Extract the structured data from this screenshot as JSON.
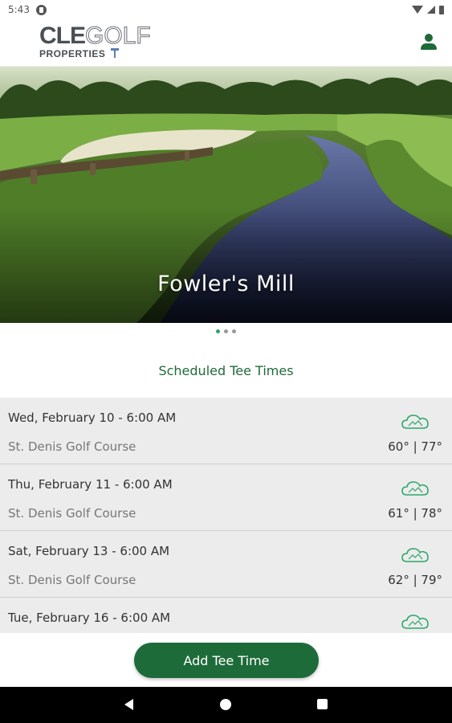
{
  "status_bar": {
    "time": "5:43"
  },
  "header": {
    "logo_main_a": "CLE",
    "logo_main_b": "GOLF",
    "logo_sub": "PROPERTIES"
  },
  "hero": {
    "title": "Fowler's Mill",
    "carousel_total": 3,
    "carousel_active": 1
  },
  "section_title": "Scheduled Tee Times",
  "tee_times": [
    {
      "date": "Wed, February 10 - 6:00 AM",
      "course": "St. Denis Golf Course",
      "temp": "60° | 77°",
      "weather_icon": "cloud-icon"
    },
    {
      "date": "Thu, February 11 - 6:00 AM",
      "course": "St. Denis Golf Course",
      "temp": "61° | 78°",
      "weather_icon": "cloud-icon"
    },
    {
      "date": "Sat, February 13 - 6:00 AM",
      "course": "St. Denis Golf Course",
      "temp": "62° | 79°",
      "weather_icon": "cloud-icon"
    },
    {
      "date": "Tue, February 16 - 6:00 AM",
      "course": "",
      "temp": "",
      "weather_icon": "cloud-icon"
    }
  ],
  "add_button_label": "Add Tee Time",
  "colors": {
    "brand_green": "#1e6b3a",
    "accent_green": "#2aa66a",
    "row_bg": "#ececec"
  }
}
